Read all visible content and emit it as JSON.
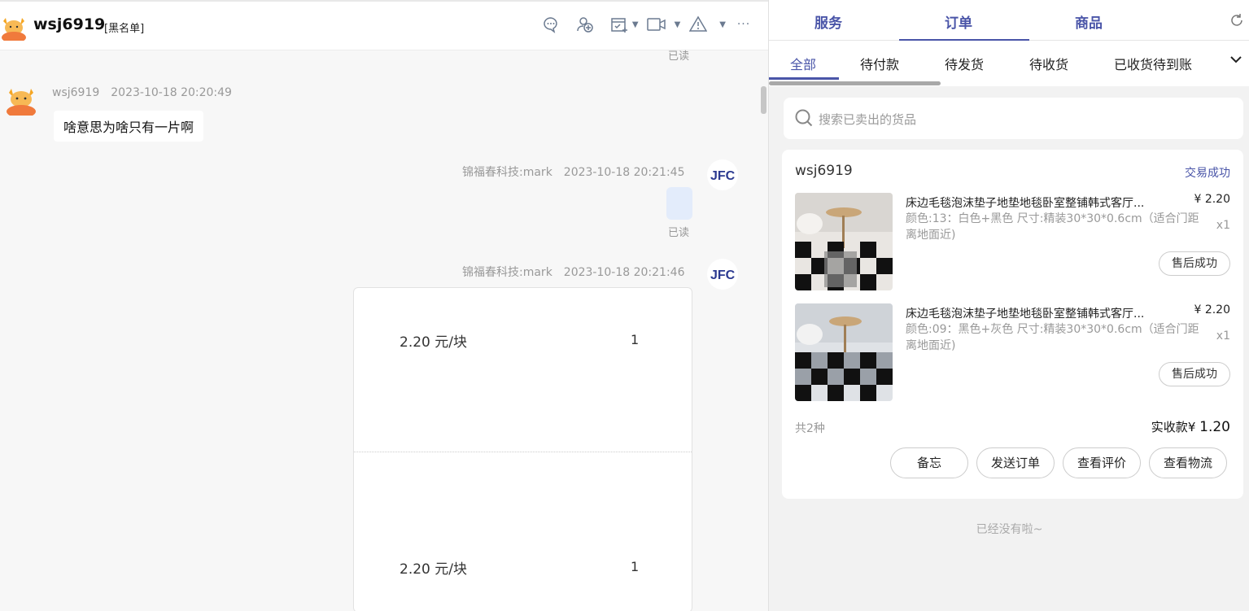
{
  "chat": {
    "contact_name": "wsj6919",
    "contact_tag": "[黑名单]",
    "header_icons": [
      "chat-bubble-icon",
      "add-contact-icon",
      "schedule-icon",
      "video-call-icon",
      "warning-icon",
      "more-icon"
    ],
    "top_read_label": "已读",
    "messages": [
      {
        "sender": "wsj6919",
        "time": "2023-10-18 20:20:49",
        "text": "啥意思为啥只有一片啊"
      },
      {
        "sender": "锦福春科技:mark",
        "time": "2023-10-18 20:21:45",
        "read": "已读"
      },
      {
        "sender": "锦福春科技:mark",
        "time": "2023-10-18 20:21:46"
      }
    ],
    "card": {
      "rows": [
        {
          "price": "2.20 元/块",
          "qty": "1"
        },
        {
          "price": "2.20 元/块",
          "qty": "1"
        }
      ]
    }
  },
  "panel": {
    "tabs": [
      "服务",
      "订单",
      "商品"
    ],
    "active_tab": "订单",
    "subtabs": [
      "全部",
      "待付款",
      "待发货",
      "待收货",
      "已收货待到账"
    ],
    "active_subtab": "全部",
    "search_placeholder": "搜索已卖出的货品",
    "order": {
      "buyer": "wsj6919",
      "status": "交易成功",
      "items": [
        {
          "title": "床边毛毯泡沫垫子地垫地毯卧室整铺韩式客厅...",
          "price": "¥ 2.20",
          "spec": "颜色:13：白色+黑色 尺寸:精装30*30*0.6cm（适合门距离地面近)",
          "qty": "x1",
          "after_sale": "售后成功"
        },
        {
          "title": "床边毛毯泡沫垫子地垫地毯卧室整铺韩式客厅...",
          "price": "¥ 2.20",
          "spec": "颜色:09：黑色+灰色 尺寸:精装30*30*0.6cm（适合门距离地面近)",
          "qty": "x1",
          "after_sale": "售后成功"
        }
      ],
      "count_text": "共2种",
      "total_label": "实收款",
      "total_currency": "¥",
      "total_amount": "1.20",
      "actions": [
        "备忘",
        "发送订单",
        "查看评价",
        "查看物流"
      ]
    },
    "end_tip": "已经没有啦~"
  },
  "colors": {
    "accent": "#4a55a8",
    "avatar_orange": "#f07a3c"
  }
}
